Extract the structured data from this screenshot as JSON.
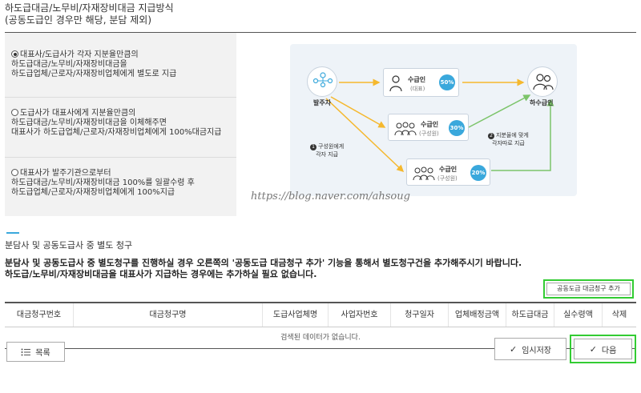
{
  "header": {
    "title_line1": "하도급대금/노무비/자재장비대금 지급방식",
    "title_line2": "(공동도급인 경우만 해당, 분담 제외)"
  },
  "payment_options": [
    {
      "selected": true,
      "line1": "대표사/도급사가 각자 지분율만큼의",
      "line2": "하도급대금/노무비/자재장비대금을",
      "line3": "하도급업체/근로자/자재장비업체에게 별도로 지급"
    },
    {
      "selected": false,
      "line1": "도급사가 대표사에게 지분율만큼의",
      "line2": "하도급대금/노무비/자재장비대금을 이체해주면",
      "line3": "대표사가 하도급업체/근로자/자재장비업체에게 100%대금지급"
    },
    {
      "selected": false,
      "line1": "대표사가 발주기관으로부터",
      "line2": "하도급대금/노무비/자재장비대금 100%를 일괄수령 후",
      "line3": "하도급업체/근로자/자재장비업체에게 100%지급"
    }
  ],
  "diagram": {
    "orderer": "발주자",
    "recipient_label": "수급인",
    "rep_sub": "(대표)",
    "member_sub": "(구성원)",
    "pct_rep": "50%",
    "pct_member1": "30%",
    "pct_member2": "20%",
    "subcontractor": "하수급인",
    "note1_num": "1",
    "note1_line1": "구성원에게",
    "note1_line2": "각자 지급",
    "note2_num": "2",
    "note2_line1": "지분율에 맞게",
    "note2_line2": "각자따로 지급",
    "watermark": "https://blog.naver.com/ahsoug",
    "accent_color": "#3aa8dc",
    "arrow_color": "#f5b82e",
    "arrow_green": "#7cc46a"
  },
  "separate_claim": {
    "title": "분담사 및 공동도급사 중 별도 청구",
    "desc_line1": "분담사 및 공동도급사 중 별도청구를 진행하실 경우 오른쪽의 '공동도급 대금청구 추가' 기능을 통해서 별도청구건을 추가해주시기 바랍니다.",
    "desc_line2": "하도급/노무비/자재장비대금을 대표사가 지급하는 경우에는 추가하실 필요 없습니다.",
    "add_button": "공동도급 대금청구 추가"
  },
  "table": {
    "columns": [
      "대금청구번호",
      "대금청구명",
      "도급사업체명",
      "사업자번호",
      "청구일자",
      "업체배정금액",
      "하도급대금",
      "실수령액",
      "삭제"
    ],
    "empty_message": "검색된 데이터가 없습니다."
  },
  "footer": {
    "list_button": "목록",
    "save_button": "임시저장",
    "next_button": "다음"
  },
  "highlight_color": "#33cc33"
}
